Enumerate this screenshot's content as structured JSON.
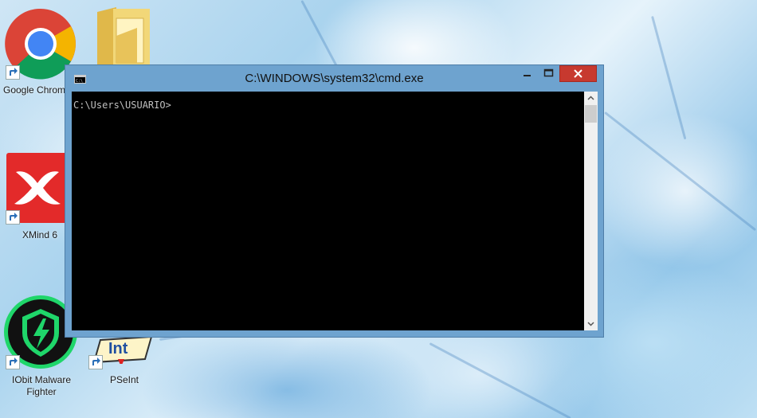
{
  "window": {
    "title": "C:\\WINDOWS\\system32\\cmd.exe",
    "prompt": "C:\\Users\\USUARIO>",
    "icon": "cmd-icon"
  },
  "desktop_icons": [
    {
      "label": "Google Chrome",
      "icon": "chrome-icon"
    },
    {
      "label": "",
      "icon": "folder-icon"
    },
    {
      "label": "XMind 6",
      "icon": "xmind-icon"
    },
    {
      "label": "IObit Malware",
      "label2": "Fighter",
      "icon": "iobit-icon"
    },
    {
      "label": "PSeInt",
      "icon": "pseint-icon",
      "badge": "Int"
    }
  ],
  "colors": {
    "titlebar": "#6ea3cf",
    "close_button": "#c7392f",
    "console_bg": "#000000",
    "console_text": "#c0c0c0"
  }
}
